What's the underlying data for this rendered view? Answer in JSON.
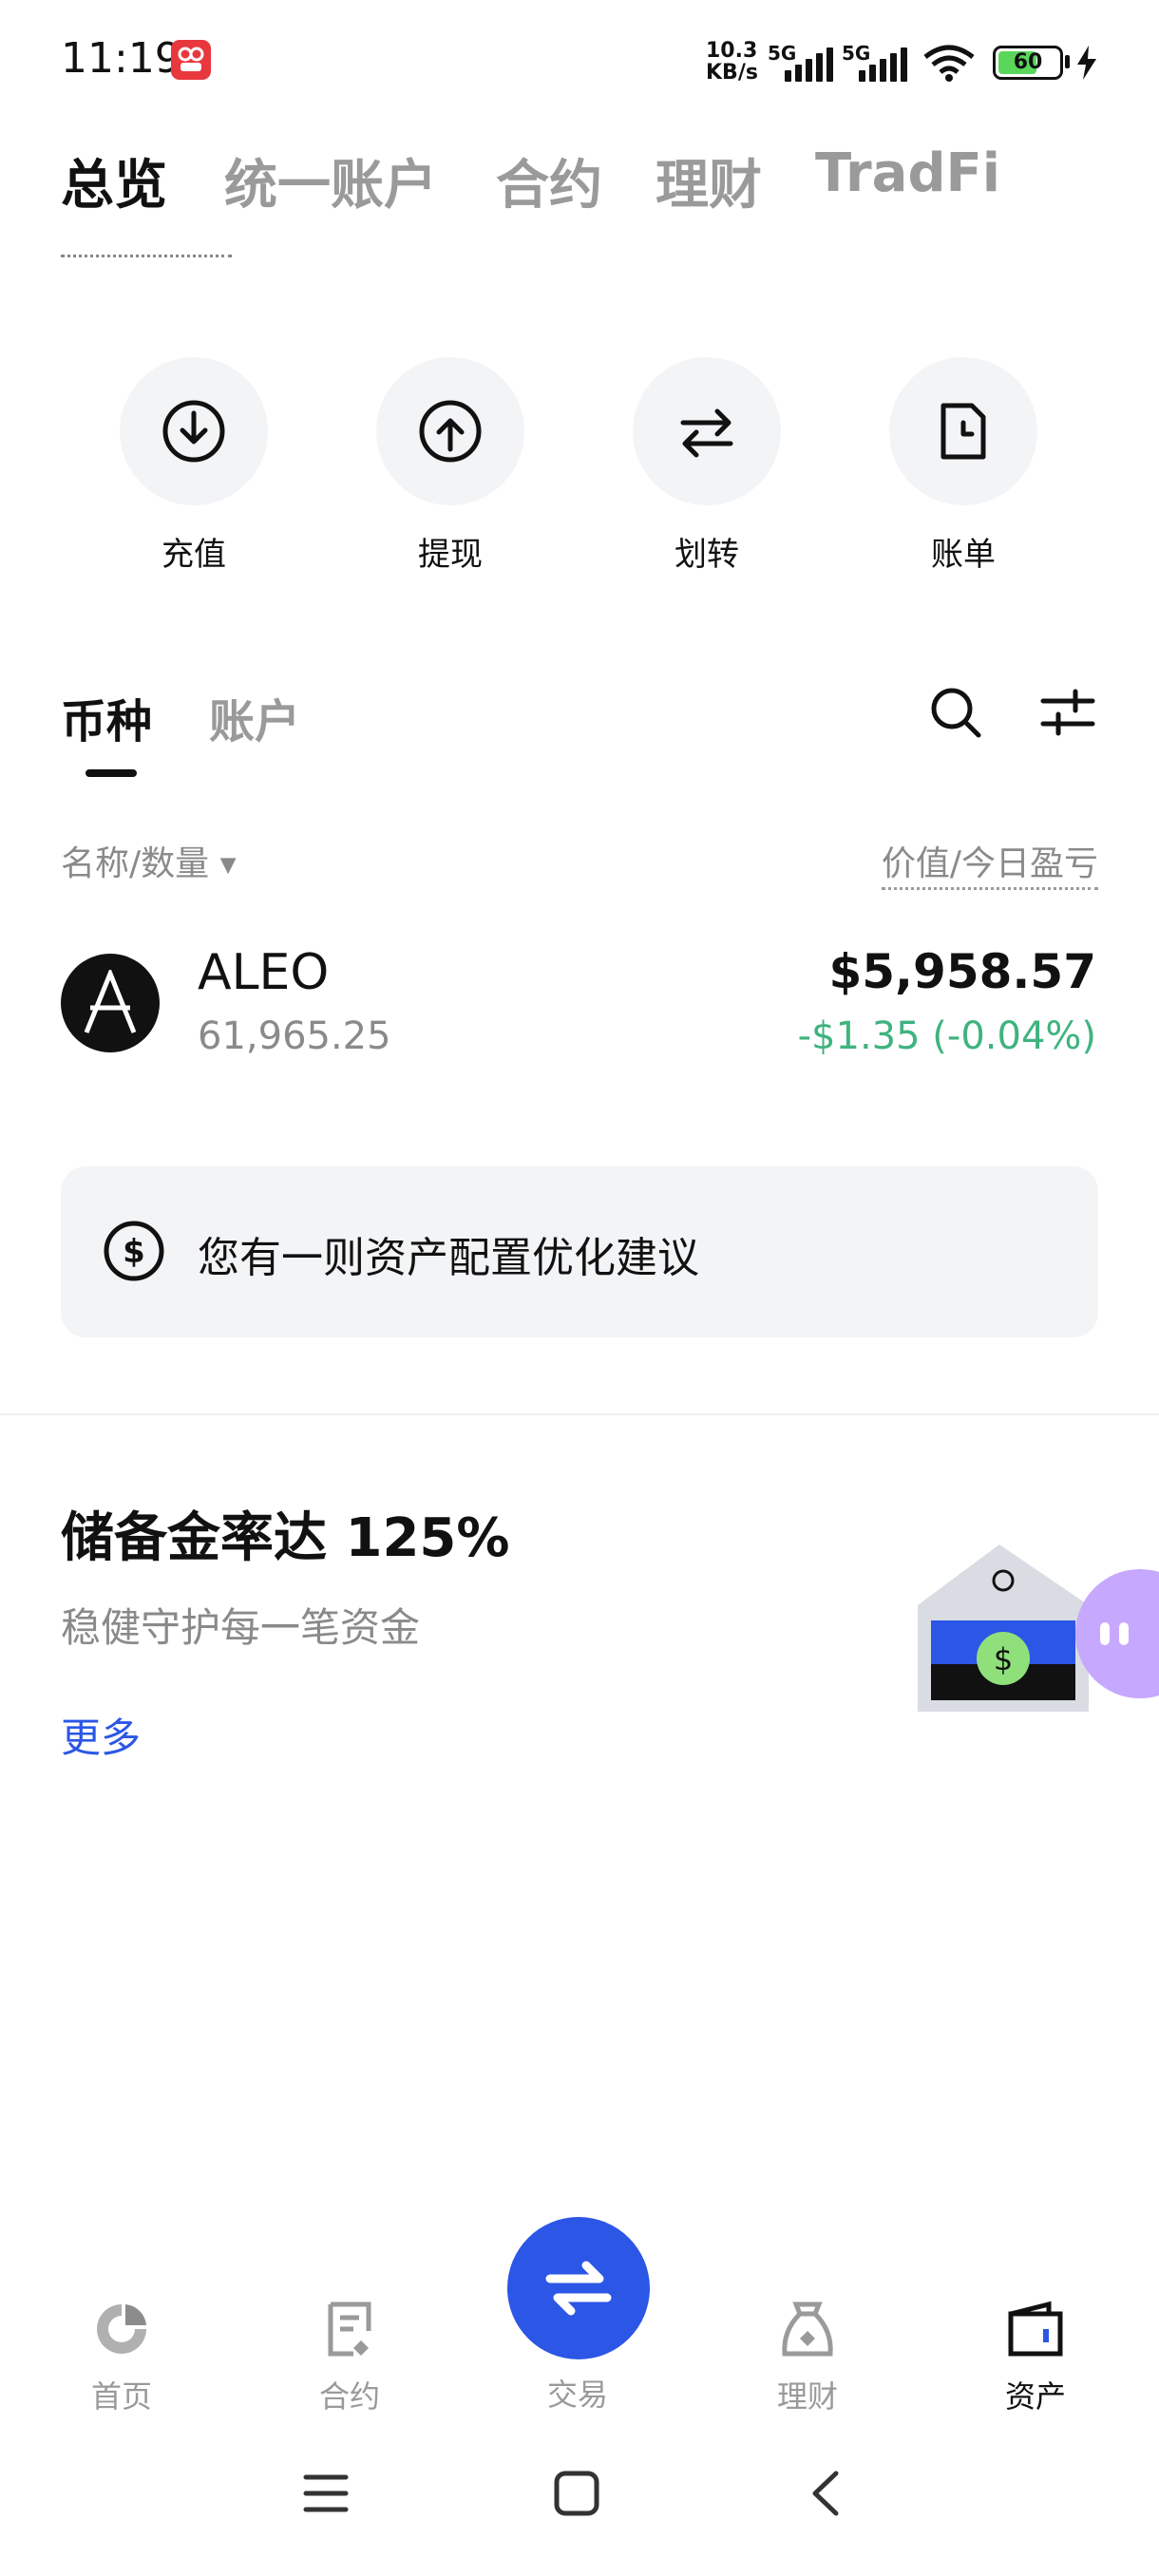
{
  "status_bar": {
    "time": "11:19",
    "net_speed_value": "10.3",
    "net_speed_unit": "KB/s",
    "sim1": "5G",
    "sim2": "5G",
    "battery": "60"
  },
  "top_tabs": [
    {
      "label": "总览",
      "active": true
    },
    {
      "label": "统一账户",
      "active": false
    },
    {
      "label": "合约",
      "active": false
    },
    {
      "label": "理财",
      "active": false
    },
    {
      "label": "TradFi",
      "active": false
    }
  ],
  "quick_actions": [
    {
      "label": "充值",
      "icon": "deposit-icon"
    },
    {
      "label": "提现",
      "icon": "withdraw-icon"
    },
    {
      "label": "划转",
      "icon": "transfer-icon"
    },
    {
      "label": "账单",
      "icon": "bill-icon"
    }
  ],
  "asset_tabs": [
    {
      "label": "币种",
      "active": true
    },
    {
      "label": "账户",
      "active": false
    }
  ],
  "columns": {
    "left": "名称/数量",
    "right": "价值/今日盈亏"
  },
  "assets": [
    {
      "symbol": "ALEO",
      "quantity": "61,965.25",
      "value": "$5,958.57",
      "pnl": "-$1.35 (-0.04%)"
    }
  ],
  "suggestion": {
    "text": "您有一则资产配置优化建议"
  },
  "reserve": {
    "title": "储备金率达 125%",
    "subtitle": "稳健守护每一笔资金",
    "more": "更多"
  },
  "bottom_nav": [
    {
      "label": "首页",
      "icon": "home-icon",
      "active": false
    },
    {
      "label": "合约",
      "icon": "contract-icon",
      "active": false
    },
    {
      "label": "交易",
      "icon": "trade-icon",
      "active": false
    },
    {
      "label": "理财",
      "icon": "earn-icon",
      "active": false
    },
    {
      "label": "资产",
      "icon": "assets-icon",
      "active": true
    }
  ],
  "colors": {
    "accent": "#2b56e6",
    "positive": "#3fb37f",
    "muted": "#9a9a9a"
  }
}
